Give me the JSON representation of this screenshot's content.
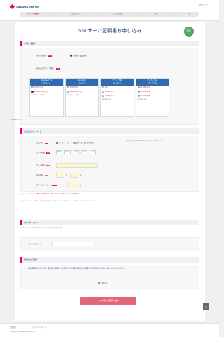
{
  "header": {
    "brand": "SAKURA Internet",
    "links": "会員メニュー ▾",
    "steps": [
      "プラン・支払選択",
      "＞",
      "会員情報の入力",
      "＞",
      "入力内容の確認",
      "＞",
      "確認",
      "＞",
      "完了"
    ]
  },
  "page": {
    "title": "SSLサーバ証明書お申し込み",
    "badge": "SSL"
  },
  "plan_section": {
    "heading": "プラン選択",
    "contract_label": "お申込み種別",
    "contract_options": [
      "新規取得",
      "更新"
    ],
    "selection_label": "お申込みプラン（期間）",
    "plans": [
      {
        "name": "Standard EV",
        "sub": "1ドメイン",
        "rows": [
          "3,300円/1年",
          "16,500円/1年一括"
        ],
        "foot": "発行時間：3〜5営業日"
      },
      {
        "name": "Standard",
        "sub": "1ドメイン",
        "rows": [
          "1,793円/1年",
          "9,900円/3年一括"
        ],
        "foot": "発行時間：1〜3営業日"
      },
      {
        "name": "ラピッドSSL",
        "sub": "1ドメイン",
        "rows": [
          "約1年",
          "1,280円/1年",
          "1,580円/1年"
        ],
        "foot": "発行時間：数分"
      },
      {
        "name": "ワイルドSSL",
        "sub": "プレミアム",
        "rows": [
          "18,480円/1年",
          "38,520円/1年",
          "45,780円/1年"
        ],
        "foot": "発行時間：数分"
      }
    ],
    "note": "※税込価格の表示です。"
  },
  "payment_section": {
    "heading": "お支払いについて",
    "method_label": "支払方法",
    "methods": [
      "クレジットカード",
      "銀行振込",
      "請求書払い"
    ],
    "brand_label": "カード種類",
    "brands": [
      "VISA",
      "MC",
      "JCB",
      "AMEX",
      "DC"
    ],
    "number_label": "カード番号",
    "number_placeholder": "",
    "expiry_label": "有効期限",
    "expiry_month": "月",
    "expiry_year": "年",
    "security_label": "セキュリティコード",
    "side_note": "お支払い方法の変更は申込後にはできません。ご確認ください。",
    "warning": "▲「クレジットカード」の場合、即時決済となります。お申し込み後のキャンセルはできません。",
    "fine_print": "ご入力いただいたカード情報は、安全な通信で送信されます。カード会社の規定により、ご利用いただけない場合があります。"
  },
  "coupon_section": {
    "heading": "クーポンコード",
    "desc": "クーポンコードをお持ちの方は入力してください。割引が適用されます。",
    "label": "クーポンコード"
  },
  "agreement_section": {
    "heading": "約款のご確認",
    "desc": "個人情報の取り扱いについてと、基本約款（PDF形式）およびSSLサービス約款（PDF形式）をご確認いただき、同意いただけましたらチェックを入れてください。",
    "checkbox_label": "同意する"
  },
  "actions": {
    "submit": "この内容で確認へ進む",
    "pagetop": "▲"
  },
  "footer": {
    "links": [
      "会社概要",
      "プライバシーポリシー"
    ],
    "copyright": "Copyright ©SAKURA internet Inc."
  }
}
